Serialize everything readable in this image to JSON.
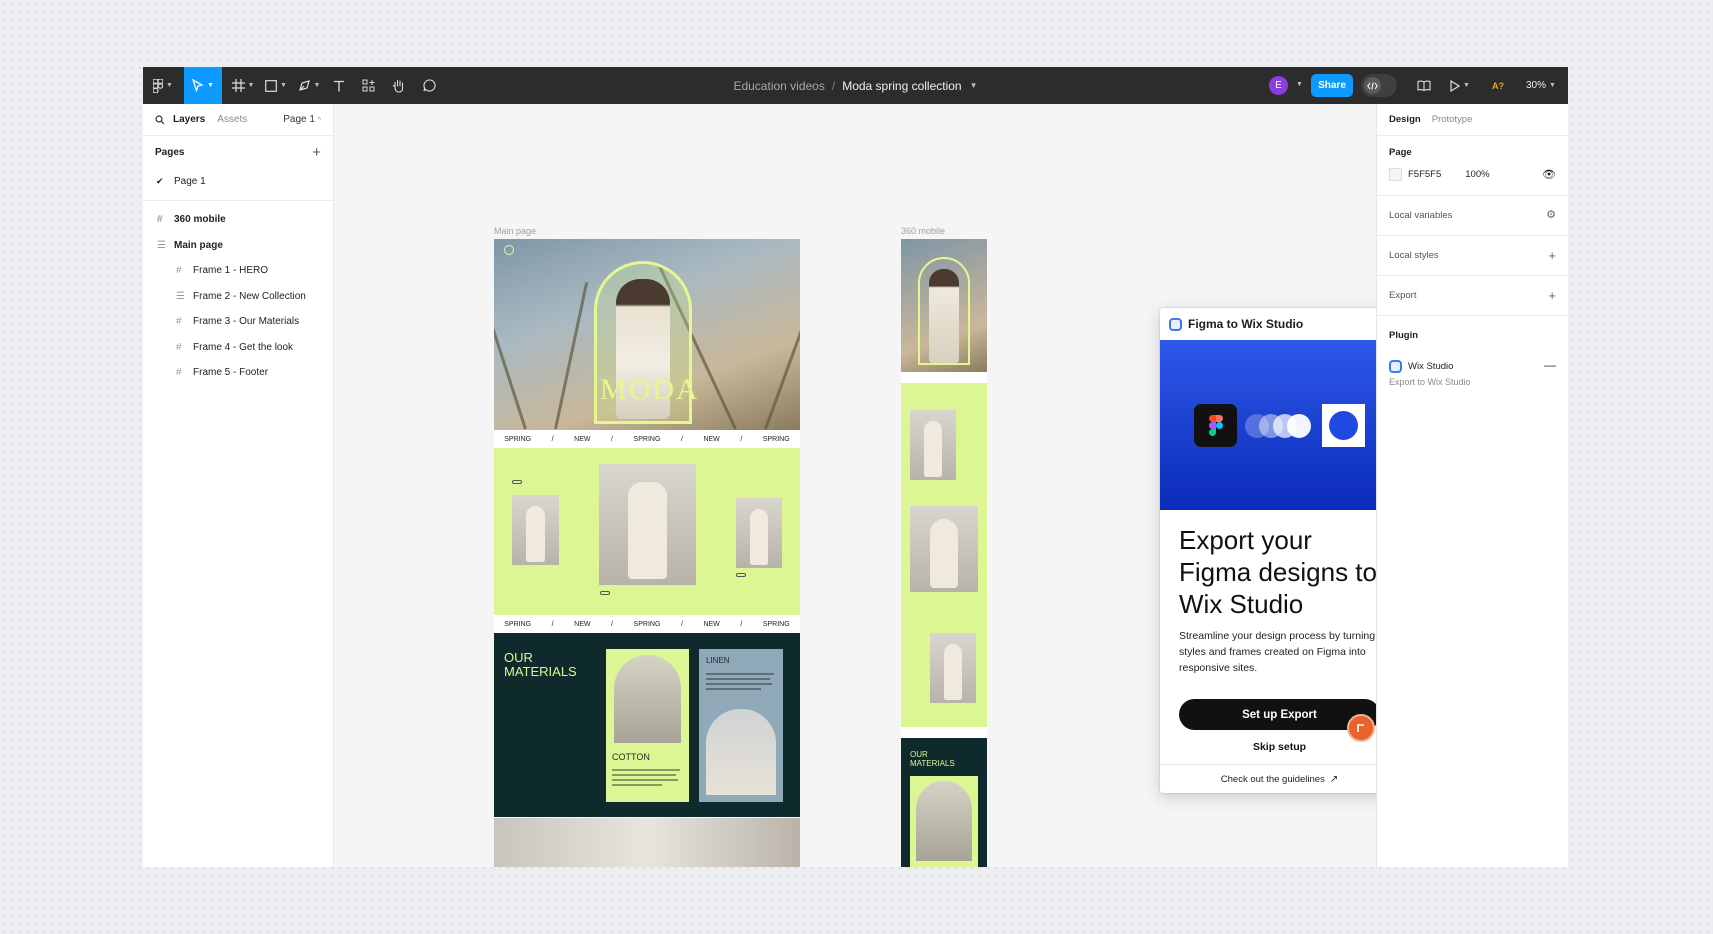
{
  "toolbar": {
    "team": "Education videos",
    "separator": "/",
    "file": "Moda spring collection",
    "avatar_letter": "E",
    "share_label": "Share",
    "ai_label": "A?",
    "zoom": "30%"
  },
  "left_panel": {
    "tab_layers": "Layers",
    "tab_assets": "Assets",
    "page_select": "Page 1",
    "pages_heading": "Pages",
    "pages": [
      {
        "label": "Page 1",
        "selected": true
      }
    ],
    "layers": [
      {
        "label": "360 mobile",
        "level": 0,
        "bold": true,
        "icon": "frame-icon"
      },
      {
        "label": "Main page",
        "level": 0,
        "bold": true,
        "icon": "autolayout-icon"
      },
      {
        "label": "Frame 1 - HERO",
        "level": 1,
        "icon": "frame-icon"
      },
      {
        "label": "Frame 2 - New Collection",
        "level": 1,
        "icon": "autolayout-icon"
      },
      {
        "label": "Frame 3 - Our Materials",
        "level": 1,
        "icon": "frame-icon"
      },
      {
        "label": "Frame 4 - Get the look",
        "level": 1,
        "icon": "frame-icon"
      },
      {
        "label": "Frame 5 - Footer",
        "level": 1,
        "icon": "frame-icon"
      }
    ]
  },
  "canvas": {
    "main_label": "Main page",
    "mobile_label": "360 mobile",
    "hero_word": "MODA",
    "marquee": [
      "SPRING",
      "/",
      "NEW",
      "/",
      "SPRING",
      "/",
      "NEW",
      "/",
      "SPRING"
    ],
    "materials_title": "OUR MATERIALS",
    "cotton": "COTTON",
    "linen": "LINEN",
    "mobile_materials": "OUR MATERIALS"
  },
  "plugin": {
    "title": "Figma to Wix Studio",
    "heading": "Export your Figma designs to Wix Studio",
    "description": "Streamline your design process by turning styles and frames created on Figma into responsive sites.",
    "cta": "Set up Export",
    "skip": "Skip setup",
    "footer_link": "Check out the guidelines"
  },
  "right_panel": {
    "tab_design": "Design",
    "tab_prototype": "Prototype",
    "page_heading": "Page",
    "page_color": "F5F5F5",
    "page_opacity": "100%",
    "local_variables": "Local variables",
    "local_styles": "Local styles",
    "export": "Export",
    "plugin_heading": "Plugin",
    "plugin_name": "Wix Studio",
    "plugin_sub": "Export to Wix Studio"
  },
  "colors": {
    "toolbar_bg": "#2c2c2c",
    "accent": "#0d99ff",
    "lime": "#dcf694",
    "dark_green": "#0f2a2d",
    "wix_blue": "#2149e0"
  }
}
